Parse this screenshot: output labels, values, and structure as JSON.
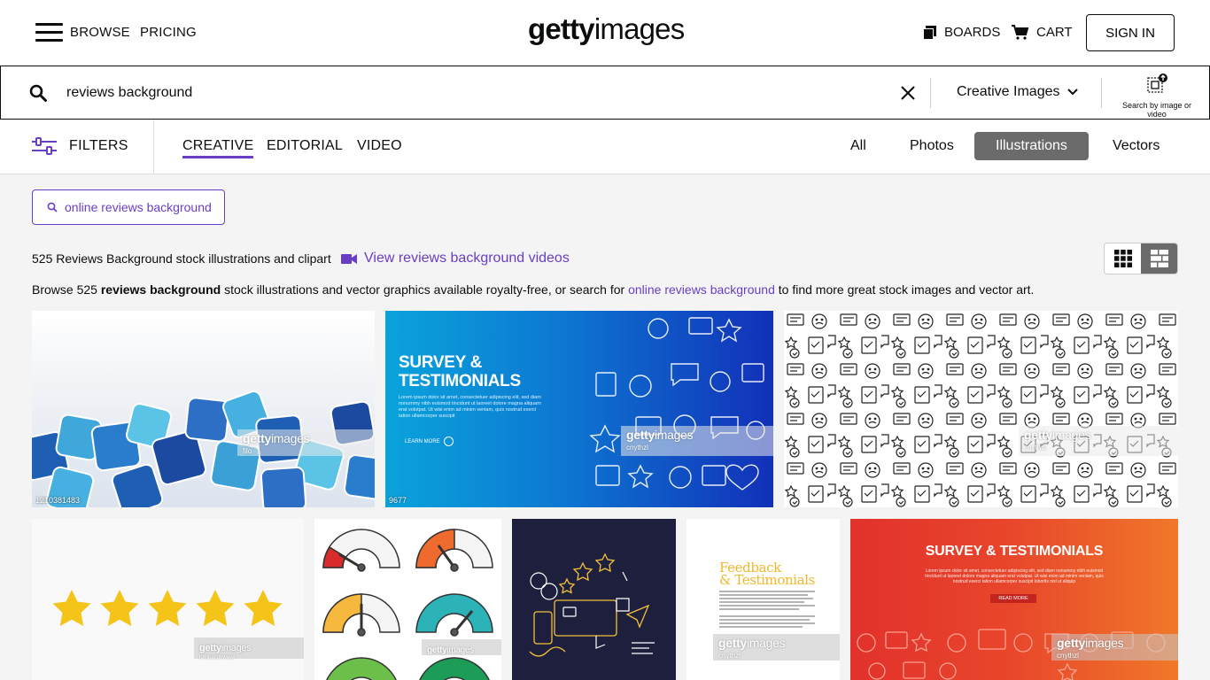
{
  "header": {
    "browse_label": "BROWSE",
    "pricing_label": "PRICING",
    "logo_bold": "getty",
    "logo_light": "images",
    "boards_label": "BOARDS",
    "cart_label": "CART",
    "signin_label": "SIGN IN"
  },
  "search": {
    "value": "reviews background",
    "type_label": "Creative Images",
    "search_by_image_label": "Search by image or video"
  },
  "filterbar": {
    "filters_label": "FILTERS",
    "asset_tabs": [
      "CREATIVE",
      "EDITORIAL",
      "VIDEO"
    ],
    "media_tabs": [
      "All",
      "Photos",
      "Illustrations",
      "Vectors"
    ]
  },
  "content": {
    "suggestion": "online reviews background",
    "count_text": "525 Reviews Background stock illustrations and clipart",
    "video_link": "View reviews background videos",
    "browse_prefix": "Browse 525 ",
    "browse_bold": "reviews background",
    "browse_mid": " stock illustrations and vector graphics available royalty-free, or search for ",
    "browse_link": "online reviews background",
    "browse_suffix": " to find more great stock images and vector art."
  },
  "tiles": {
    "t1": {
      "credit": "filo",
      "id": "1210381483"
    },
    "t2": {
      "headline_1": "SURVEY &",
      "headline_2": "TESTIMONIALS",
      "body": "Lorem ipsum dolor sit amet, consectetuer adipiscing elit, sed diam nonummy nibh euismod tincidunt ut laoreet dolore magna aliquam erat volutpat. Ut wisi enim ad minim veniam, quis nostrud exerci tation ullamcorper suscipit",
      "cta": "LEARN MORE",
      "credit": "cnythzl",
      "id": "9677"
    },
    "t3": {
      "credit": "cnythzl"
    },
    "t4": {
      "credit": "tombaconwave"
    },
    "t7": {
      "headline_1": "Feedback",
      "headline_2": "& Testimonials",
      "credit": "cnythzl"
    },
    "t8": {
      "headline": "SURVEY & TESTIMONIALS",
      "body": "Lorem ipsum dolor sit amet, consectetuer adipiscing elit, sed diam nonummy nibh euismod tincidunt ut laoreet dolore magna aliquam erat volutpat. Ut wisi enim ad minim veniam, quis nostrud exerci tation ullamcorper suscipit lobortis nisl ut aliquip",
      "cta": "READ MORE",
      "credit": "cnythzl"
    },
    "watermark_bold": "getty",
    "watermark_light": "images"
  },
  "colors": {
    "accent": "#6a3ec4",
    "active_tab_bg": "#6b6b6b",
    "page_bg": "#f4f4f4"
  }
}
